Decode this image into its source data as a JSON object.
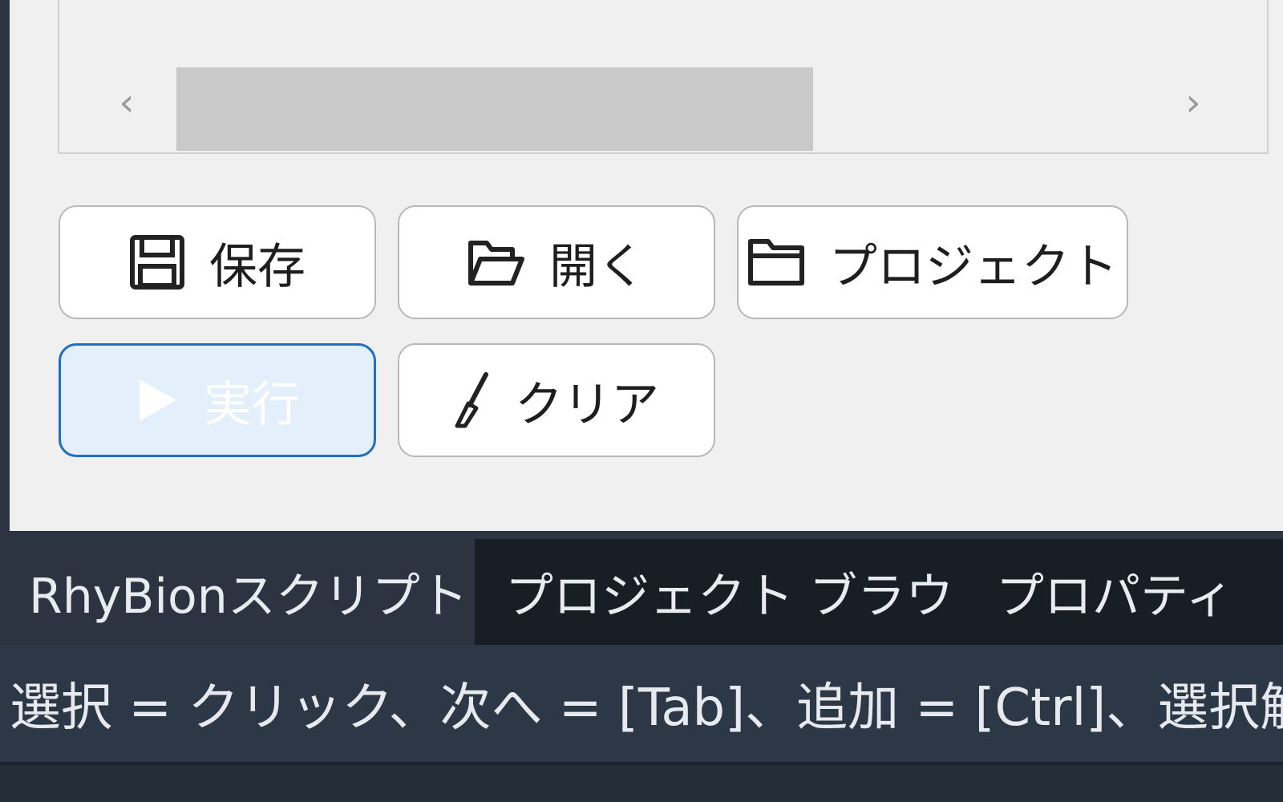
{
  "editor": {
    "scroll_left_glyph": "‹",
    "scroll_right_glyph": "›",
    "scroll_thumb_fraction": 0.65
  },
  "buttons": {
    "save": {
      "label": "保存",
      "icon": "floppy-disk-icon"
    },
    "open": {
      "label": "開く",
      "icon": "folder-open-icon"
    },
    "project": {
      "label": "プロジェクト",
      "icon": "folder-icon"
    },
    "run": {
      "label": "実行",
      "icon": "play-icon",
      "state": "disabled"
    },
    "clear": {
      "label": "クリア",
      "icon": "brush-icon"
    }
  },
  "tabs": [
    {
      "label": "RhyBionスクリプト",
      "active": true
    },
    {
      "label": "プロジェクト ブラウ...",
      "active": false
    },
    {
      "label": "プロパティ",
      "active": false
    }
  ],
  "status": {
    "hint": "選択 = クリック、次へ = [Tab]、追加 = [Ctrl]、選択解除 = [Shift]"
  },
  "colors": {
    "panel_bg": "#f0f0f0",
    "primary_border": "#1e6fc1",
    "primary_bg": "#e3effa",
    "tabbar_bg": "#181e25",
    "active_tab_bg": "#2b3440",
    "status_bg": "#2d3846"
  }
}
